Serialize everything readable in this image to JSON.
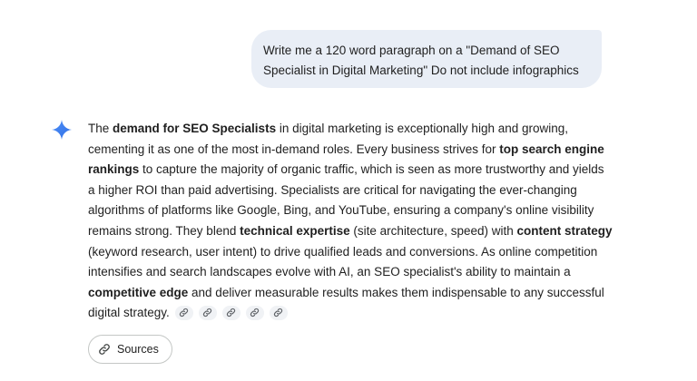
{
  "user_message": {
    "line1": "Write me a 120 word paragraph on a \"Demand of SEO",
    "line2": "Specialist in Digital Marketing\" Do not include infographics"
  },
  "response": {
    "icon": "gemini-spark-icon",
    "lines": [
      {
        "t1": "The ",
        "b1": "demand for SEO Specialists",
        "t2": " in digital marketing is exceptionally high and growing,"
      },
      {
        "t1": "cementing it as one of the most in-demand roles. Every business strives for ",
        "b1": "top search engine"
      },
      {
        "b1": "rankings",
        "t2": " to capture the majority of organic traffic, which is seen as more trustworthy and yields"
      },
      {
        "t1": "a higher ROI than paid advertising. Specialists are critical for navigating the ever-changing"
      },
      {
        "t1": "algorithms of platforms like Google, Bing, and YouTube, ensuring a company's online visibility"
      },
      {
        "t1": "remains strong. They blend ",
        "b1": "technical expertise",
        "t2": " (site architecture, speed) with ",
        "b2": "content strategy"
      },
      {
        "t1": "(keyword research, user intent) to drive qualified leads and conversions. As online competition"
      },
      {
        "t1": "intensifies and search landscapes evolve with AI, an SEO specialist's ability to maintain a"
      },
      {
        "b1": "competitive edge",
        "t2": " and deliver measurable results makes them indispensable to any successful"
      },
      {
        "t1": "digital strategy."
      }
    ],
    "citation_icon": "link-icon",
    "citation_count": 5
  },
  "sources_button": {
    "label": "Sources",
    "icon": "link-icon"
  },
  "colors": {
    "user_bubble_bg": "#e9eef6",
    "text": "#1f1f1f",
    "spark_blue": "#4285f4",
    "chip_bg": "#f0f2f5",
    "border": "#c4c7c5"
  }
}
